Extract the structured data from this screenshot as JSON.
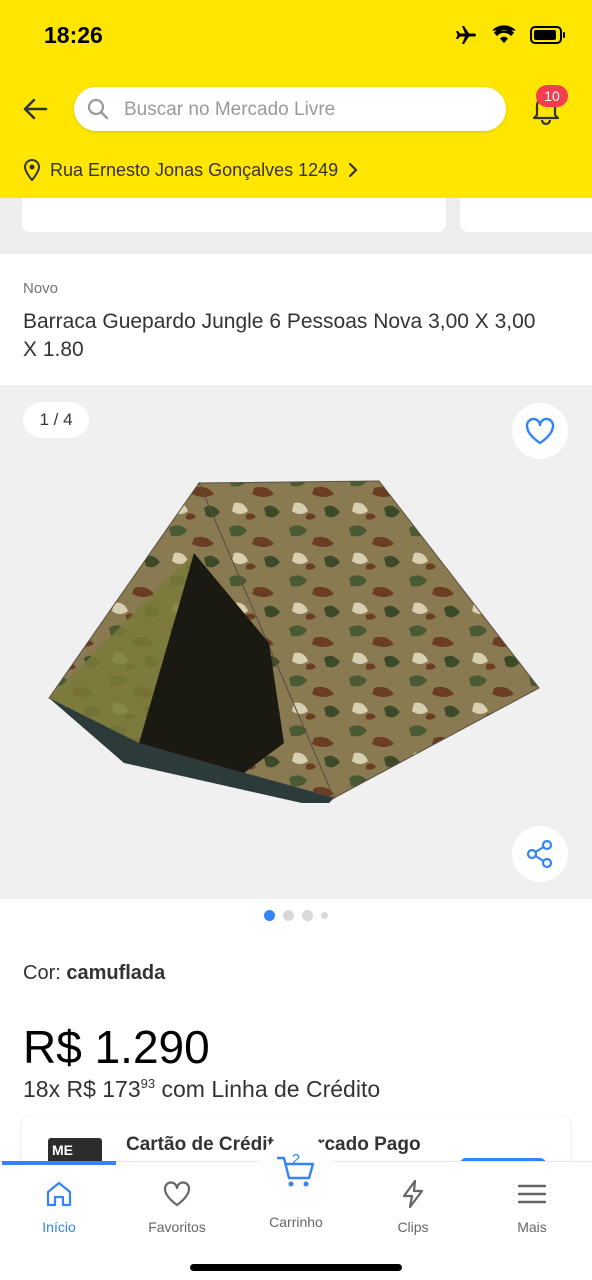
{
  "status_bar": {
    "time": "18:26"
  },
  "header": {
    "search_placeholder": "Buscar no Mercado Livre",
    "notification_count": "10",
    "address": "Rua Ernesto Jonas Gonçalves 1249",
    "accent_color": "#FFE600"
  },
  "product": {
    "condition": "Novo",
    "title": "Barraca Guepardo Jungle 6 Pessoas Nova 3,00 X 3,00 X 1.80",
    "gallery_counter": "1 / 4",
    "color_label": "Cor: ",
    "color_value": "camuflada",
    "price": "R$ 1.290",
    "installment_prefix": "18x R$ 173",
    "installment_cents": "93",
    "installment_suffix": " com Linha de Crédito"
  },
  "promo_card": {
    "text": "Cartão de Crédito Mercado Pago",
    "card_logo": "ME"
  },
  "tabbar": {
    "tabs": [
      {
        "label": "Início",
        "icon": "home-icon"
      },
      {
        "label": "Favoritos",
        "icon": "heart-icon"
      },
      {
        "label": "Carrinho",
        "icon": "cart-icon"
      },
      {
        "label": "Clips",
        "icon": "lightning-icon"
      },
      {
        "label": "Mais",
        "icon": "menu-icon"
      }
    ],
    "cart_count": "2",
    "active_color": "#3483FA"
  }
}
